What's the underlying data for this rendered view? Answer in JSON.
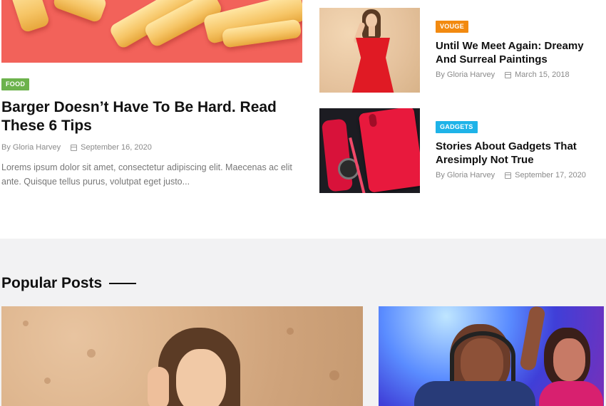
{
  "featured": {
    "category": "FOOD",
    "title": "Barger Doesn’t Have To Be Hard. Read These 6 Tips",
    "author": "By Gloria Harvey",
    "date": "September 16, 2020",
    "excerpt": "Lorems ipsum dolor sit amet, consectetur adipiscing elit. Maecenas ac elit ante. Quisque tellus purus, volutpat eget justo..."
  },
  "side_posts": [
    {
      "category": "VOUGE",
      "title": "Until We Meet Again: Dreamy And Surreal Paintings",
      "author": "By Gloria Harvey",
      "date": "March 15, 2018"
    },
    {
      "category": "GADGETS",
      "title": "Stories About Gadgets That Aresimply Not True",
      "author": "By Gloria Harvey",
      "date": "September 17, 2020"
    }
  ],
  "popular": {
    "heading": "Popular Posts"
  },
  "colors": {
    "food_tag": "#6cb24c",
    "vouge_tag": "#f28a10",
    "gadgets_tag": "#1eb3e8",
    "section_bg": "#f2f2f3"
  },
  "icons": {
    "date": "calendar-icon"
  }
}
